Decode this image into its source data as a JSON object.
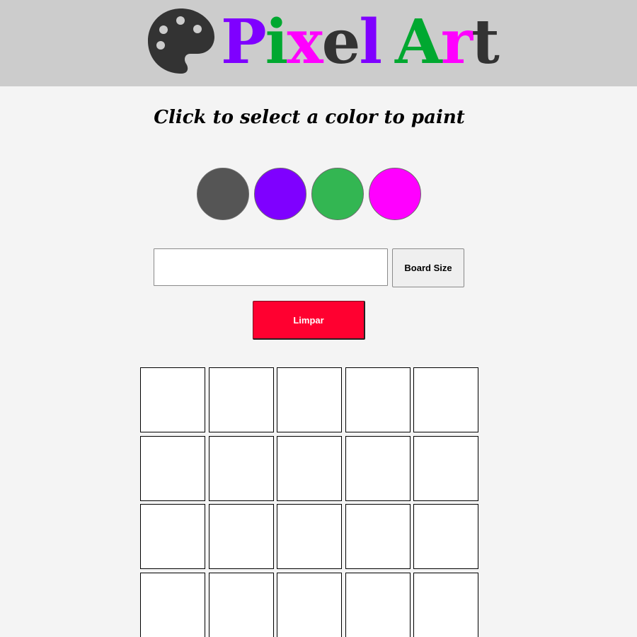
{
  "header": {
    "logo_icon": "palette-icon",
    "title_letters": [
      {
        "char": "P",
        "color": "#7f00ff"
      },
      {
        "char": "i",
        "color": "#00a830"
      },
      {
        "char": "x",
        "color": "#ff00ff"
      },
      {
        "char": "e",
        "color": "#333333"
      },
      {
        "char": "l",
        "color": "#7f00ff"
      },
      {
        "char": " ",
        "color": "#333333"
      },
      {
        "char": "A",
        "color": "#00a830"
      },
      {
        "char": "r",
        "color": "#ff00ff"
      },
      {
        "char": "t",
        "color": "#333333"
      }
    ]
  },
  "instructions": "Click to select a color to paint",
  "palette": {
    "colors": [
      "#555555",
      "#7f00ff",
      "#33b652",
      "#ff00ff"
    ],
    "selected_index": 0
  },
  "board_input": {
    "value": "",
    "placeholder": ""
  },
  "buttons": {
    "board_size_label": "Board Size",
    "clear_label": "Limpar"
  },
  "board": {
    "columns": 5,
    "rows_visible": 4,
    "pixel_color": "#ffffff"
  }
}
